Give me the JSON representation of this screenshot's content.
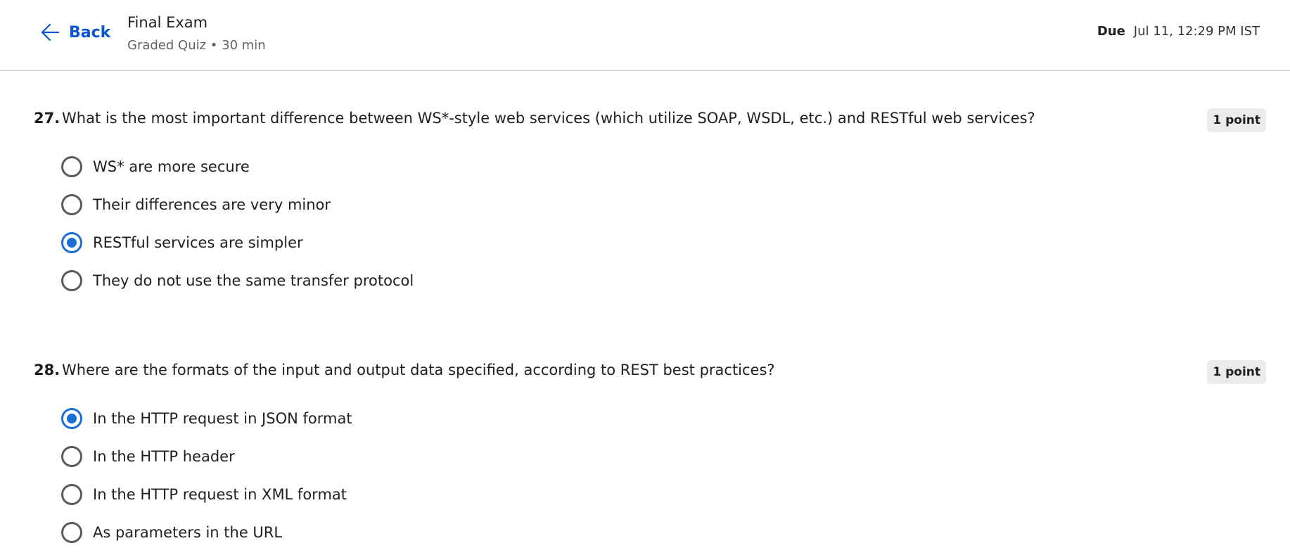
{
  "header": {
    "back_label": "Back",
    "title": "Final Exam",
    "subtitle": "Graded Quiz • 30 min",
    "due_label": "Due",
    "due_value": "Jul 11, 12:29 PM IST"
  },
  "questions": [
    {
      "number": "27.",
      "text": "What is the most important difference between WS*-style web services (which utilize SOAP, WSDL, etc.) and RESTful web services?",
      "points": "1 point",
      "options": [
        {
          "label": "WS* are more secure",
          "selected": false
        },
        {
          "label": "Their differences are very minor",
          "selected": false
        },
        {
          "label": "RESTful services are simpler",
          "selected": true
        },
        {
          "label": "They do not use the same transfer protocol",
          "selected": false
        }
      ]
    },
    {
      "number": "28.",
      "text": "Where are the formats of the input and output data specified, according to REST best practices?",
      "points": "1 point",
      "options": [
        {
          "label": "In the HTTP request in JSON format",
          "selected": true
        },
        {
          "label": "In the HTTP header",
          "selected": false
        },
        {
          "label": "In the HTTP request in XML format",
          "selected": false
        },
        {
          "label": "As parameters in the URL",
          "selected": false
        }
      ]
    }
  ],
  "colors": {
    "accent": "#0a56d0",
    "radio_selected": "#1a6fd4",
    "badge_bg": "#ebebeb"
  }
}
